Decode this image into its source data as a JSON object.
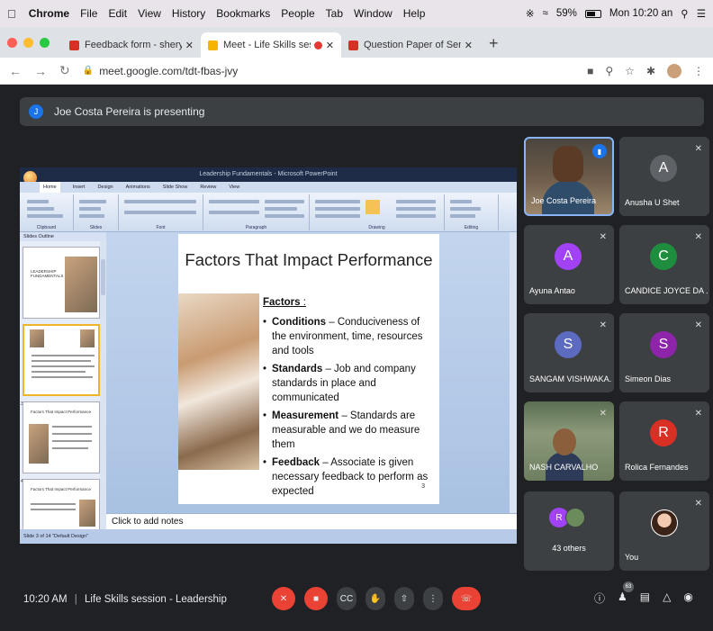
{
  "menubar": {
    "app": "Chrome",
    "items": [
      "File",
      "Edit",
      "View",
      "History",
      "Bookmarks",
      "People",
      "Tab",
      "Window",
      "Help"
    ],
    "battery": "59%",
    "clock": "Mon 10:20 an"
  },
  "tabs": [
    {
      "title": "Feedback form - sheryl.dasilv",
      "favicon_color": "#d93025"
    },
    {
      "title": "Meet - Life Skills session -",
      "favicon_color": "#f4b400",
      "active": true,
      "recording": true
    },
    {
      "title": "Question Paper of Semester-I",
      "favicon_color": "#d93025"
    }
  ],
  "address": {
    "url": "meet.google.com/tdt-fbas-jvy"
  },
  "presenting": {
    "initial": "J",
    "text": "Joe Costa Pereira is presenting"
  },
  "powerpoint": {
    "title_bar": "Leadership Fundamentals - Microsoft PowerPoint",
    "ribbon_tabs": [
      "Home",
      "Insert",
      "Design",
      "Animations",
      "Slide Show",
      "Review",
      "View"
    ],
    "ribbon_groups": [
      "Clipboard",
      "Slides",
      "Font",
      "Paragraph",
      "Drawing",
      "Editing"
    ],
    "panel_tabs": "Slides  Outline",
    "thumb_titles": [
      "LEADERSHIP FUNDAMENTALS",
      "Factors That Impact Performance",
      "Factors That Impact Performance"
    ],
    "slide": {
      "title": "Factors That Impact Performance",
      "factors_label": "Factors",
      "bullets": [
        {
          "head": "Conditions",
          "text": " – Conduciveness of the environment, time, resources and tools"
        },
        {
          "head": "Standards",
          "text": " – Job and company standards in place and communicated"
        },
        {
          "head": "Measurement",
          "text": " – Standards are measurable and we do measure them"
        },
        {
          "head": "Feedback",
          "text": " – Associate is given necessary feedback to perform as expected"
        }
      ],
      "page": "3"
    },
    "notes_placeholder": "Click to add notes",
    "status": "Slide 3 of 14   \"Default Design\""
  },
  "participants": [
    {
      "name": "Joe Costa Pereira",
      "type": "video"
    },
    {
      "name": "Anusha U Shet",
      "initial": "A",
      "color": "#5f6368"
    },
    {
      "name": "Ayuna Antao",
      "initial": "A",
      "color": "#a142f4"
    },
    {
      "name": "CANDICE JOYCE DA ...",
      "initial": "C",
      "color": "#1e8e3e"
    },
    {
      "name": "SANGAM VISHWAKA...",
      "initial": "S",
      "color": "#5c6bc0"
    },
    {
      "name": "Simeon Dias",
      "initial": "S",
      "color": "#8e24aa"
    },
    {
      "name": "NASH CARVALHO",
      "type": "video"
    },
    {
      "name": "Rolica Fernandes",
      "initial": "R",
      "color": "#d93025"
    }
  ],
  "others": {
    "initial": "R",
    "label": "43 others"
  },
  "self": {
    "label": "You"
  },
  "bottom": {
    "time": "10:20 AM",
    "separator": "|",
    "meeting": "Life Skills session - Leadership",
    "people_count": "63"
  }
}
